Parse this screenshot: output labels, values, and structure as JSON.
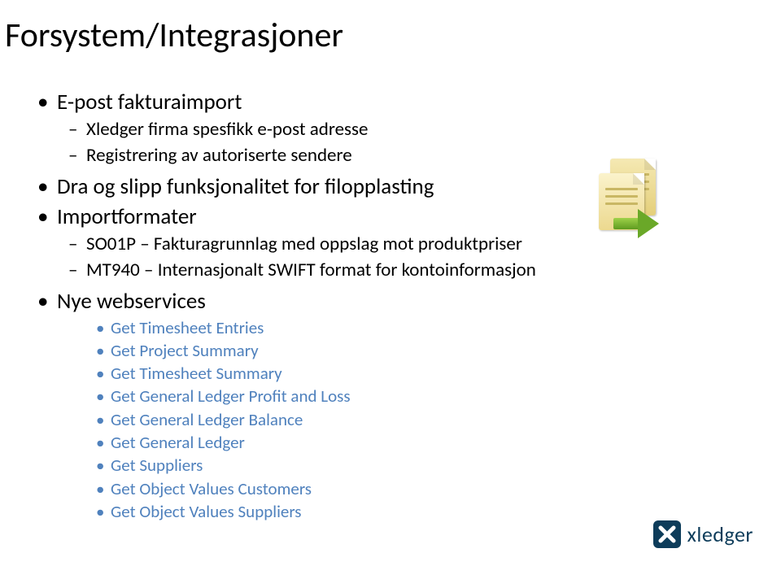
{
  "title": "Forsystem/Integrasjoner",
  "bullets": {
    "b1": {
      "label": "E-post fakturaimport",
      "sub": [
        "Xledger firma spesfikk e-post adresse",
        "Registrering av autoriserte sendere"
      ]
    },
    "b2": {
      "label": "Dra og slipp funksjonalitet for filopplasting"
    },
    "b3": {
      "label": "Importformater",
      "sub": [
        "SO01P – Fakturagrunnlag med oppslag mot produktpriser",
        "MT940 – Internasjonalt SWIFT format for kontoinformasjon"
      ]
    },
    "b4": {
      "label": "Nye webservices",
      "ws": [
        "Get Timesheet Entries",
        "Get Project Summary",
        "Get Timesheet Summary",
        "Get General Ledger Profit and Loss",
        "Get General Ledger Balance",
        "Get General Ledger",
        "Get Suppliers",
        "Get Object Values Customers",
        "Get Object Values Suppliers"
      ]
    }
  },
  "logo_text": "xledger"
}
